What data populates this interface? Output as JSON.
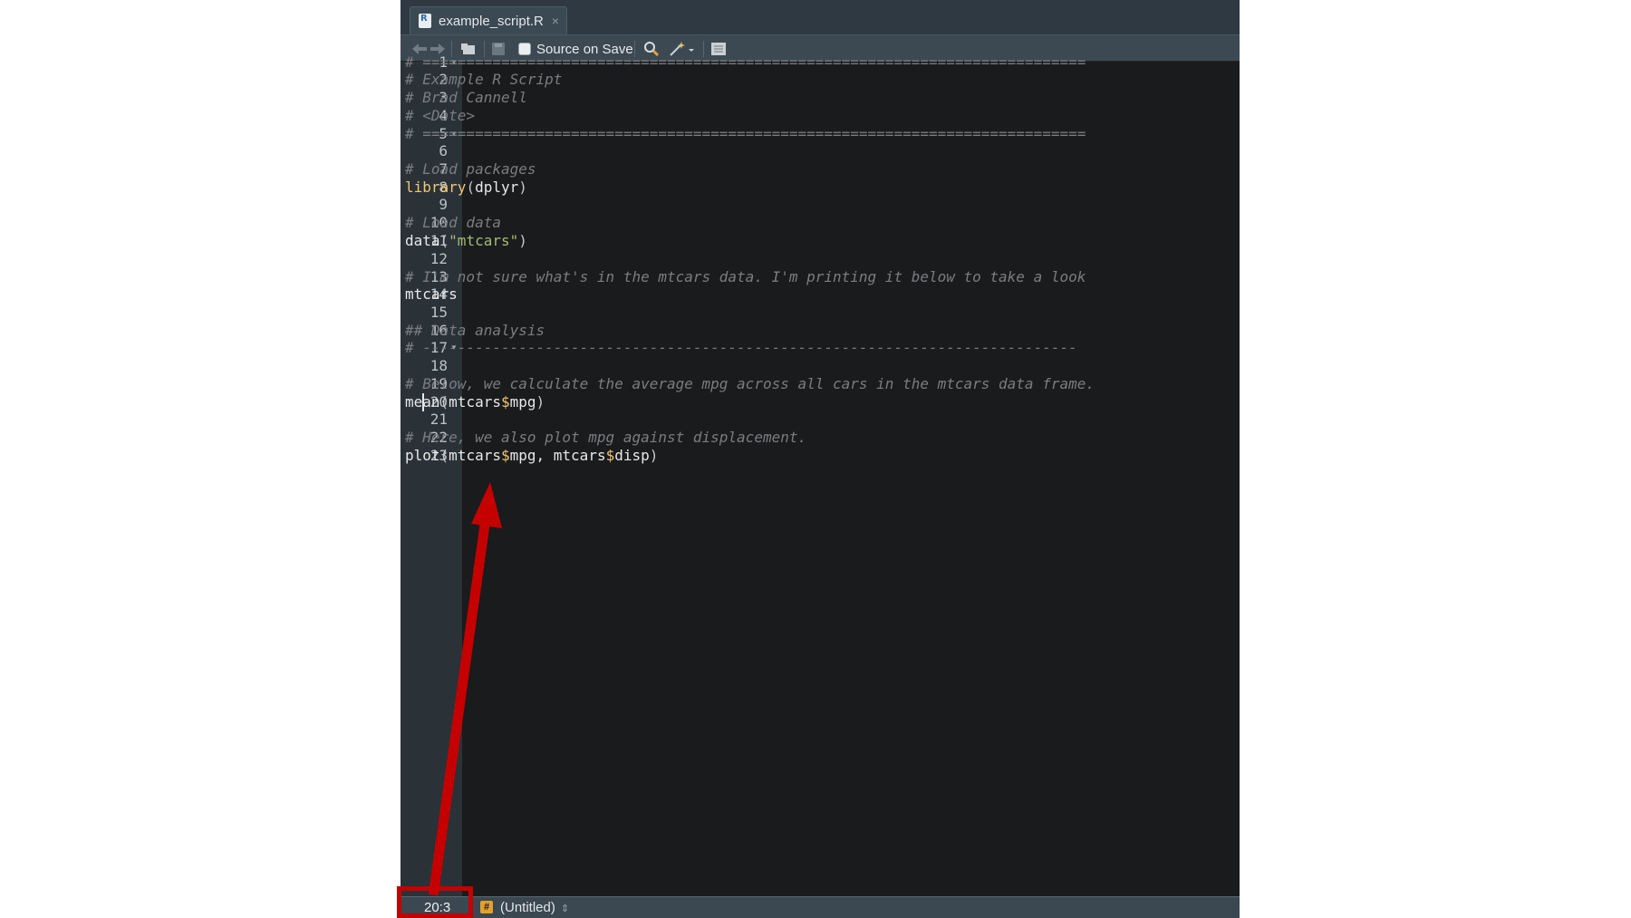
{
  "tab": {
    "filename": "example_script.R",
    "close": "×",
    "r_badge": "R"
  },
  "toolbar": {
    "source_on_save_label": "Source on Save",
    "source_on_save_checked": false,
    "icons": [
      "back-arrow-icon",
      "forward-arrow-icon",
      "show-in-window-icon",
      "save-icon",
      "search-icon",
      "magic-wand-icon",
      "compile-report-icon"
    ]
  },
  "editor": {
    "line_numbers": [
      "1",
      "2",
      "3",
      "4",
      "5",
      "6",
      "7",
      "8",
      "9",
      "10",
      "11",
      "12",
      "13",
      "14",
      "15",
      "16",
      "17",
      "18",
      "19",
      "20",
      "21",
      "22",
      "23"
    ],
    "folds": [
      "1",
      "5",
      "17"
    ],
    "lines": {
      "l1": "# ============================================================================",
      "l2": "# Example R Script",
      "l3": "# Brad Cannell",
      "l4": "# <Date>",
      "l5": "# ============================================================================",
      "l7": "# Load packages",
      "l8_fn": "library",
      "l8_arg": "dplyr",
      "l10": "# Load data",
      "l11_fn": "data",
      "l11_str": "\"mtcars\"",
      "l13": "# I'm not sure what's in the mtcars data. I'm printing it below to take a look",
      "l14": "mtcars",
      "l16": "## Data analysis",
      "l17": "# ---------------------------------------------------------------------------",
      "l19": "# Below, we calculate the average mpg across all cars in the mtcars data frame.",
      "l20_fn": "mean",
      "l20_a": "mtcars",
      "l20_b": "mpg",
      "l22": "# Here, we also plot mpg against displacement.",
      "l23_fn": "plot",
      "l23_a": "mtcars",
      "l23_b": "mpg",
      "l23_c": "mtcars",
      "l23_d": "disp"
    }
  },
  "statusbar": {
    "cursor_position": "20:3",
    "file_type": "(Untitled)",
    "hash_icon": "#"
  },
  "colors": {
    "highlight": "#c40000",
    "comment": "#7a7d80",
    "function": "#f0c674",
    "string": "#a4b97a"
  }
}
